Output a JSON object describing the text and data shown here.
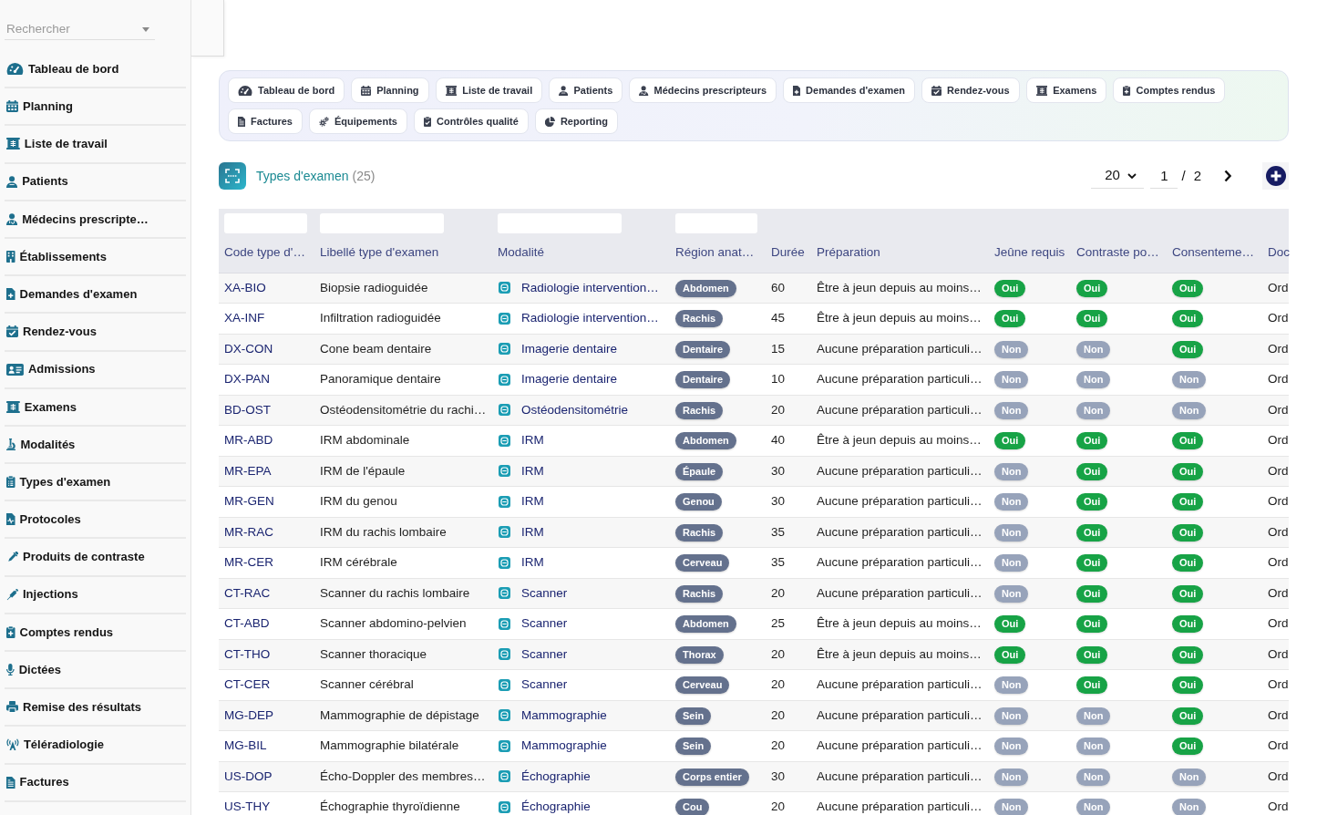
{
  "sidebar": {
    "search": {
      "placeholder": "Rechercher"
    },
    "items": [
      "Tableau de bord",
      "Planning",
      "Liste de travail",
      "Patients",
      "Médecins prescripte…",
      "Établissements",
      "Demandes d'examen",
      "Rendez-vous",
      "Admissions",
      "Examens",
      "Modalités",
      "Types d'examen",
      "Protocoles",
      "Produits de contraste",
      "Injections",
      "Comptes rendus",
      "Dictées",
      "Remise des résultats",
      "Téléradiologie",
      "Factures"
    ]
  },
  "quick_nav": [
    "Tableau de bord",
    "Planning",
    "Liste de travail",
    "Patients",
    "Médecins prescripteurs",
    "Demandes d'examen",
    "Rendez-vous",
    "Examens",
    "Comptes rendus",
    "Factures",
    "Équipements",
    "Contrôles qualité",
    "Reporting"
  ],
  "header": {
    "title": "Types d'examen",
    "count": "(25)",
    "page_size": "20",
    "page": "1",
    "separator": "/",
    "page_count": "2"
  },
  "table": {
    "columns": [
      {
        "label": "Code type d'…",
        "filter": true
      },
      {
        "label": "Libellé type d'examen",
        "filter": true
      },
      {
        "label": "Modalité",
        "filter": true
      },
      {
        "label": "Région anat…",
        "filter": true
      },
      {
        "label": "Durée",
        "filter": false
      },
      {
        "label": "Préparation",
        "filter": false
      },
      {
        "label": "Jeûne requis",
        "filter": false
      },
      {
        "label": "Contraste po…",
        "filter": false
      },
      {
        "label": "Consenteme…",
        "filter": false
      },
      {
        "label": "Doc",
        "filter": false
      }
    ],
    "rows": [
      {
        "code": "XA-BIO",
        "label": "Biopsie radioguidée",
        "modality": "Radiologie intervention…",
        "region": "Abdomen",
        "duration": "60",
        "preparation": "Être à jeun depuis au moins…",
        "flags": [
          {
            "text": "Oui",
            "on": true
          },
          {
            "text": "Oui",
            "on": true
          },
          {
            "text": "Oui",
            "on": true
          }
        ],
        "doc": "Ord"
      },
      {
        "code": "XA-INF",
        "label": "Infiltration radioguidée",
        "modality": "Radiologie intervention…",
        "region": "Rachis",
        "duration": "45",
        "preparation": "Être à jeun depuis au moins…",
        "flags": [
          {
            "text": "Oui",
            "on": true
          },
          {
            "text": "Oui",
            "on": true
          },
          {
            "text": "Oui",
            "on": true
          }
        ],
        "doc": "Ord"
      },
      {
        "code": "DX-CON",
        "label": "Cone beam dentaire",
        "modality": "Imagerie dentaire",
        "region": "Dentaire",
        "duration": "15",
        "preparation": "Aucune préparation particuli…",
        "flags": [
          {
            "text": "Non",
            "on": false
          },
          {
            "text": "Non",
            "on": false
          },
          {
            "text": "Oui",
            "on": true
          }
        ],
        "doc": "Ord"
      },
      {
        "code": "DX-PAN",
        "label": "Panoramique dentaire",
        "modality": "Imagerie dentaire",
        "region": "Dentaire",
        "duration": "10",
        "preparation": "Aucune préparation particuli…",
        "flags": [
          {
            "text": "Non",
            "on": false
          },
          {
            "text": "Non",
            "on": false
          },
          {
            "text": "Non",
            "on": false
          }
        ],
        "doc": "Ord"
      },
      {
        "code": "BD-OST",
        "label": "Ostéodensitométrie du rachi…",
        "modality": "Ostéodensitométrie",
        "region": "Rachis",
        "duration": "20",
        "preparation": "Aucune préparation particuli…",
        "flags": [
          {
            "text": "Non",
            "on": false
          },
          {
            "text": "Non",
            "on": false
          },
          {
            "text": "Non",
            "on": false
          }
        ],
        "doc": "Ord"
      },
      {
        "code": "MR-ABD",
        "label": "IRM abdominale",
        "modality": "IRM",
        "region": "Abdomen",
        "duration": "40",
        "preparation": "Être à jeun depuis au moins…",
        "flags": [
          {
            "text": "Oui",
            "on": true
          },
          {
            "text": "Oui",
            "on": true
          },
          {
            "text": "Oui",
            "on": true
          }
        ],
        "doc": "Ord"
      },
      {
        "code": "MR-EPA",
        "label": "IRM de l'épaule",
        "modality": "IRM",
        "region": "Épaule",
        "duration": "30",
        "preparation": "Aucune préparation particuli…",
        "flags": [
          {
            "text": "Non",
            "on": false
          },
          {
            "text": "Oui",
            "on": true
          },
          {
            "text": "Oui",
            "on": true
          }
        ],
        "doc": "Ord"
      },
      {
        "code": "MR-GEN",
        "label": "IRM du genou",
        "modality": "IRM",
        "region": "Genou",
        "duration": "30",
        "preparation": "Aucune préparation particuli…",
        "flags": [
          {
            "text": "Non",
            "on": false
          },
          {
            "text": "Oui",
            "on": true
          },
          {
            "text": "Oui",
            "on": true
          }
        ],
        "doc": "Ord"
      },
      {
        "code": "MR-RAC",
        "label": "IRM du rachis lombaire",
        "modality": "IRM",
        "region": "Rachis",
        "duration": "35",
        "preparation": "Aucune préparation particuli…",
        "flags": [
          {
            "text": "Non",
            "on": false
          },
          {
            "text": "Oui",
            "on": true
          },
          {
            "text": "Oui",
            "on": true
          }
        ],
        "doc": "Ord"
      },
      {
        "code": "MR-CER",
        "label": "IRM cérébrale",
        "modality": "IRM",
        "region": "Cerveau",
        "duration": "35",
        "preparation": "Aucune préparation particuli…",
        "flags": [
          {
            "text": "Non",
            "on": false
          },
          {
            "text": "Oui",
            "on": true
          },
          {
            "text": "Oui",
            "on": true
          }
        ],
        "doc": "Ord"
      },
      {
        "code": "CT-RAC",
        "label": "Scanner du rachis lombaire",
        "modality": "Scanner",
        "region": "Rachis",
        "duration": "20",
        "preparation": "Aucune préparation particuli…",
        "flags": [
          {
            "text": "Non",
            "on": false
          },
          {
            "text": "Oui",
            "on": true
          },
          {
            "text": "Oui",
            "on": true
          }
        ],
        "doc": "Ord"
      },
      {
        "code": "CT-ABD",
        "label": "Scanner abdomino-pelvien",
        "modality": "Scanner",
        "region": "Abdomen",
        "duration": "25",
        "preparation": "Être à jeun depuis au moins…",
        "flags": [
          {
            "text": "Oui",
            "on": true
          },
          {
            "text": "Oui",
            "on": true
          },
          {
            "text": "Oui",
            "on": true
          }
        ],
        "doc": "Ord"
      },
      {
        "code": "CT-THO",
        "label": "Scanner thoracique",
        "modality": "Scanner",
        "region": "Thorax",
        "duration": "20",
        "preparation": "Être à jeun depuis au moins…",
        "flags": [
          {
            "text": "Oui",
            "on": true
          },
          {
            "text": "Oui",
            "on": true
          },
          {
            "text": "Oui",
            "on": true
          }
        ],
        "doc": "Ord"
      },
      {
        "code": "CT-CER",
        "label": "Scanner cérébral",
        "modality": "Scanner",
        "region": "Cerveau",
        "duration": "20",
        "preparation": "Aucune préparation particuli…",
        "flags": [
          {
            "text": "Non",
            "on": false
          },
          {
            "text": "Oui",
            "on": true
          },
          {
            "text": "Oui",
            "on": true
          }
        ],
        "doc": "Ord"
      },
      {
        "code": "MG-DEP",
        "label": "Mammographie de dépistage",
        "modality": "Mammographie",
        "region": "Sein",
        "duration": "20",
        "preparation": "Aucune préparation particuli…",
        "flags": [
          {
            "text": "Non",
            "on": false
          },
          {
            "text": "Non",
            "on": false
          },
          {
            "text": "Oui",
            "on": true
          }
        ],
        "doc": "Ord"
      },
      {
        "code": "MG-BIL",
        "label": "Mammographie bilatérale",
        "modality": "Mammographie",
        "region": "Sein",
        "duration": "20",
        "preparation": "Aucune préparation particuli…",
        "flags": [
          {
            "text": "Non",
            "on": false
          },
          {
            "text": "Non",
            "on": false
          },
          {
            "text": "Oui",
            "on": true
          }
        ],
        "doc": "Ord"
      },
      {
        "code": "US-DOP",
        "label": "Écho-Doppler des membres…",
        "modality": "Échographie",
        "region": "Corps entier",
        "duration": "30",
        "preparation": "Aucune préparation particuli…",
        "flags": [
          {
            "text": "Non",
            "on": false
          },
          {
            "text": "Non",
            "on": false
          },
          {
            "text": "Non",
            "on": false
          }
        ],
        "doc": "Ord"
      },
      {
        "code": "US-THY",
        "label": "Échographie thyroïdienne",
        "modality": "Échographie",
        "region": "Cou",
        "duration": "20",
        "preparation": "Aucune préparation particuli…",
        "flags": [
          {
            "text": "Non",
            "on": false
          },
          {
            "text": "Non",
            "on": false
          },
          {
            "text": "Non",
            "on": false
          }
        ],
        "doc": "Ord"
      }
    ]
  }
}
